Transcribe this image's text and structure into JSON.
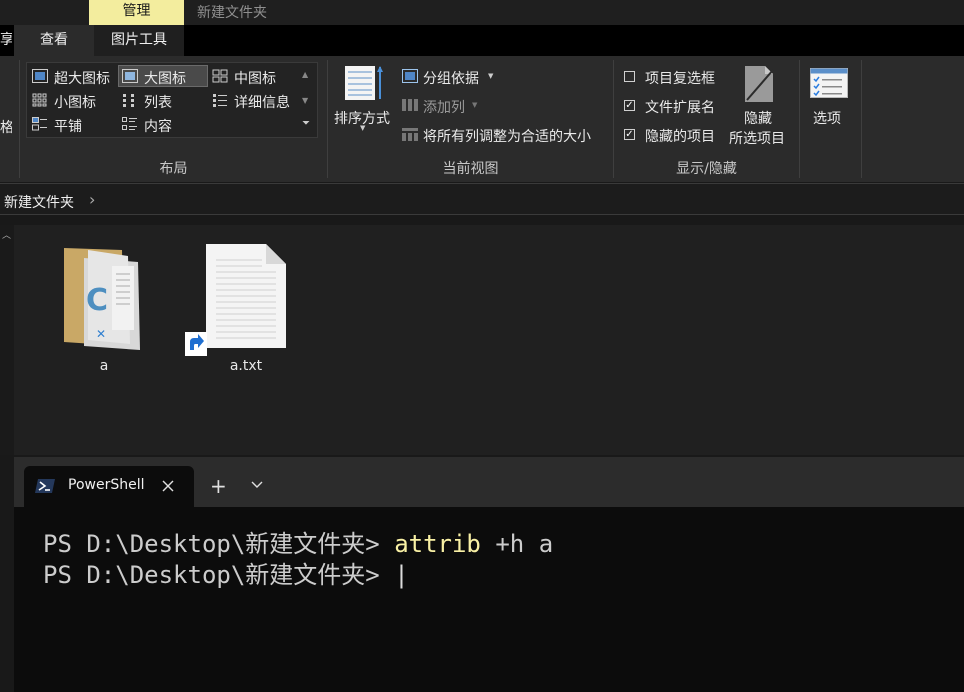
{
  "titlebar": {
    "context_tab": "管理",
    "title": "新建文件夹"
  },
  "ribbon_tabs": {
    "share": "享",
    "view": "查看",
    "picture_tools": "图片工具"
  },
  "layout_group": {
    "label": "布局",
    "items": {
      "extra_large": "超大图标",
      "large": "大图标",
      "medium": "中图标",
      "small": "小图标",
      "list": "列表",
      "details": "详细信息",
      "tiles": "平铺",
      "content": "内容"
    },
    "truncated_left": "格"
  },
  "current_view_group": {
    "label": "当前视图",
    "sort_by": "排序方式",
    "group_by": "分组依据",
    "add_columns": "添加列",
    "size_columns": "将所有列调整为合适的大小"
  },
  "show_hide_group": {
    "label": "显示/隐藏",
    "item_checkboxes": {
      "label": "项目复选框",
      "checked": false
    },
    "file_extensions": {
      "label": "文件扩展名",
      "checked": true
    },
    "hidden_items": {
      "label": "隐藏的项目",
      "checked": true
    },
    "hide_selected_line1": "隐藏",
    "hide_selected_line2": "所选项目"
  },
  "options": {
    "label": "选项"
  },
  "address_bar": {
    "crumb": "新建文件夹",
    "chevron": "›"
  },
  "files": [
    {
      "name": "a",
      "icon": "folder-vscode-icon"
    },
    {
      "name": "a.txt",
      "icon": "text-file-shortcut-icon"
    }
  ],
  "terminal": {
    "tab_title": "PowerShell",
    "new_tab": "+",
    "dropdown": "⌄",
    "line1_prompt": "PS D:\\Desktop\\新建文件夹> ",
    "line1_command": "attrib",
    "line1_args": " +h a",
    "line2_prompt": "PS D:\\Desktop\\新建文件夹> ",
    "cursor": "|"
  },
  "colors": {
    "context_tab": "#f3ed9e",
    "command_highlight": "#f9f1a5",
    "terminal_bg": "#0c0c0c"
  }
}
